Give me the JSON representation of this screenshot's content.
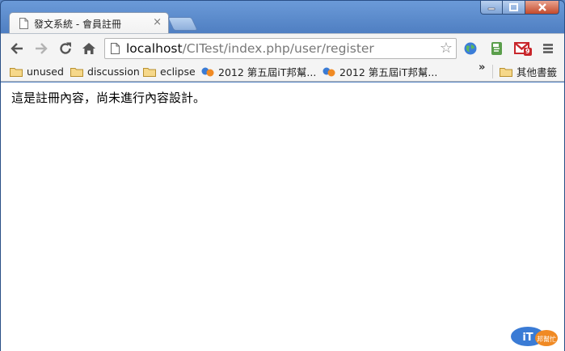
{
  "tab": {
    "title": "發文系統 - 會員註冊",
    "close": "×"
  },
  "address": {
    "host": "localhost",
    "path": "/CITest/index.php/user/register"
  },
  "bookmarks": [
    {
      "label": "unused",
      "icon": "folder-icon"
    },
    {
      "label": "discussion",
      "icon": "folder-icon"
    },
    {
      "label": "eclipse",
      "icon": "folder-icon"
    },
    {
      "label": "2012 第五屆iT邦幫...",
      "icon": "ithome-favicon"
    },
    {
      "label": "2012 第五屆iT邦幫...",
      "icon": "ithome-favicon"
    }
  ],
  "bookmarks_overflow": "»",
  "other_bookmarks": "其他書籤",
  "mail_badge": "9",
  "content": {
    "text": "這是註冊內容，尚未進行內容設計。"
  },
  "watermark": {
    "text": "iT邦幫忙"
  },
  "colors": {
    "titlebar": "#5a86c5",
    "host": "#111111",
    "path": "#787878",
    "mail": "#c8262b"
  }
}
